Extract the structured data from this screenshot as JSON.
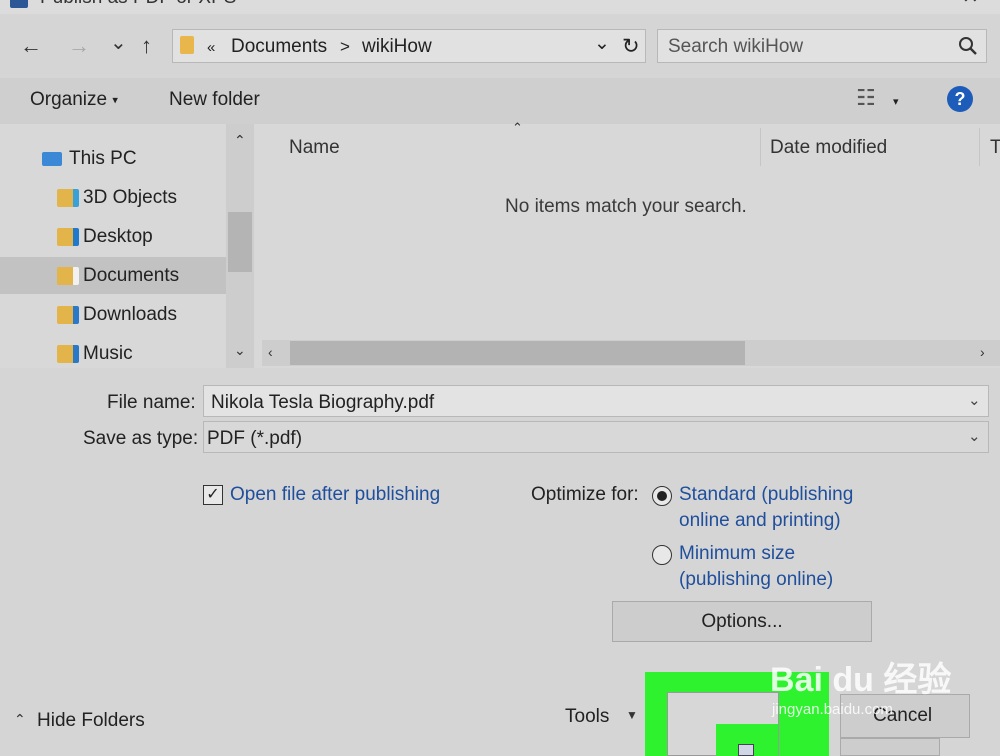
{
  "window": {
    "title": "Publish as PDF or XPS"
  },
  "navigation": {
    "back_icon": "←",
    "forward_icon": "→",
    "recent_icon": "⌄",
    "up_icon": "↑",
    "breadcrumb_overflow": "«",
    "breadcrumb": [
      "Documents",
      "wikiHow"
    ],
    "breadcrumb_sep": ">",
    "dropdown_icon": "⌄",
    "refresh_icon": "↻",
    "search_placeholder": "Search wikiHow",
    "search_icon": "🔍"
  },
  "toolbar": {
    "organize_label": "Organize",
    "new_folder_label": "New folder",
    "view_icon": "☷",
    "help_label": "?"
  },
  "nav_pane": {
    "items": [
      {
        "label": "This PC",
        "icon": "computer-icon"
      },
      {
        "label": "3D Objects",
        "icon": "folder-3d-icon"
      },
      {
        "label": "Desktop",
        "icon": "folder-desktop-icon"
      },
      {
        "label": "Documents",
        "icon": "folder-documents-icon",
        "selected": true
      },
      {
        "label": "Downloads",
        "icon": "folder-downloads-icon"
      },
      {
        "label": "Music",
        "icon": "folder-music-icon"
      }
    ]
  },
  "file_list": {
    "columns": [
      "Name",
      "Date modified",
      "T"
    ],
    "empty_message": "No items match your search."
  },
  "form": {
    "file_name_label": "File name:",
    "file_name_value": "Nikola Tesla Biography.pdf",
    "save_as_type_label": "Save as type:",
    "save_as_type_value": "PDF (*.pdf)",
    "open_after_label": "Open file after publishing",
    "open_after_checked": true,
    "optimize_label": "Optimize for:",
    "optimize_options": [
      {
        "line1": "Standard (publishing",
        "line2": "online and printing)",
        "selected": true
      },
      {
        "line1": "Minimum size",
        "line2": "(publishing online)",
        "selected": false
      }
    ],
    "options_button": "Options..."
  },
  "footer": {
    "hide_folders_label": "Hide Folders",
    "tools_label": "Tools",
    "publish_button": "",
    "cancel_button": "Cancel"
  },
  "watermark": {
    "brand": "Bai du 经验",
    "url": "jingyan.baidu.com"
  },
  "colors": {
    "highlight": "#2df22d",
    "help_blue": "#1d5cb8",
    "link_blue": "#1f4f9c"
  }
}
